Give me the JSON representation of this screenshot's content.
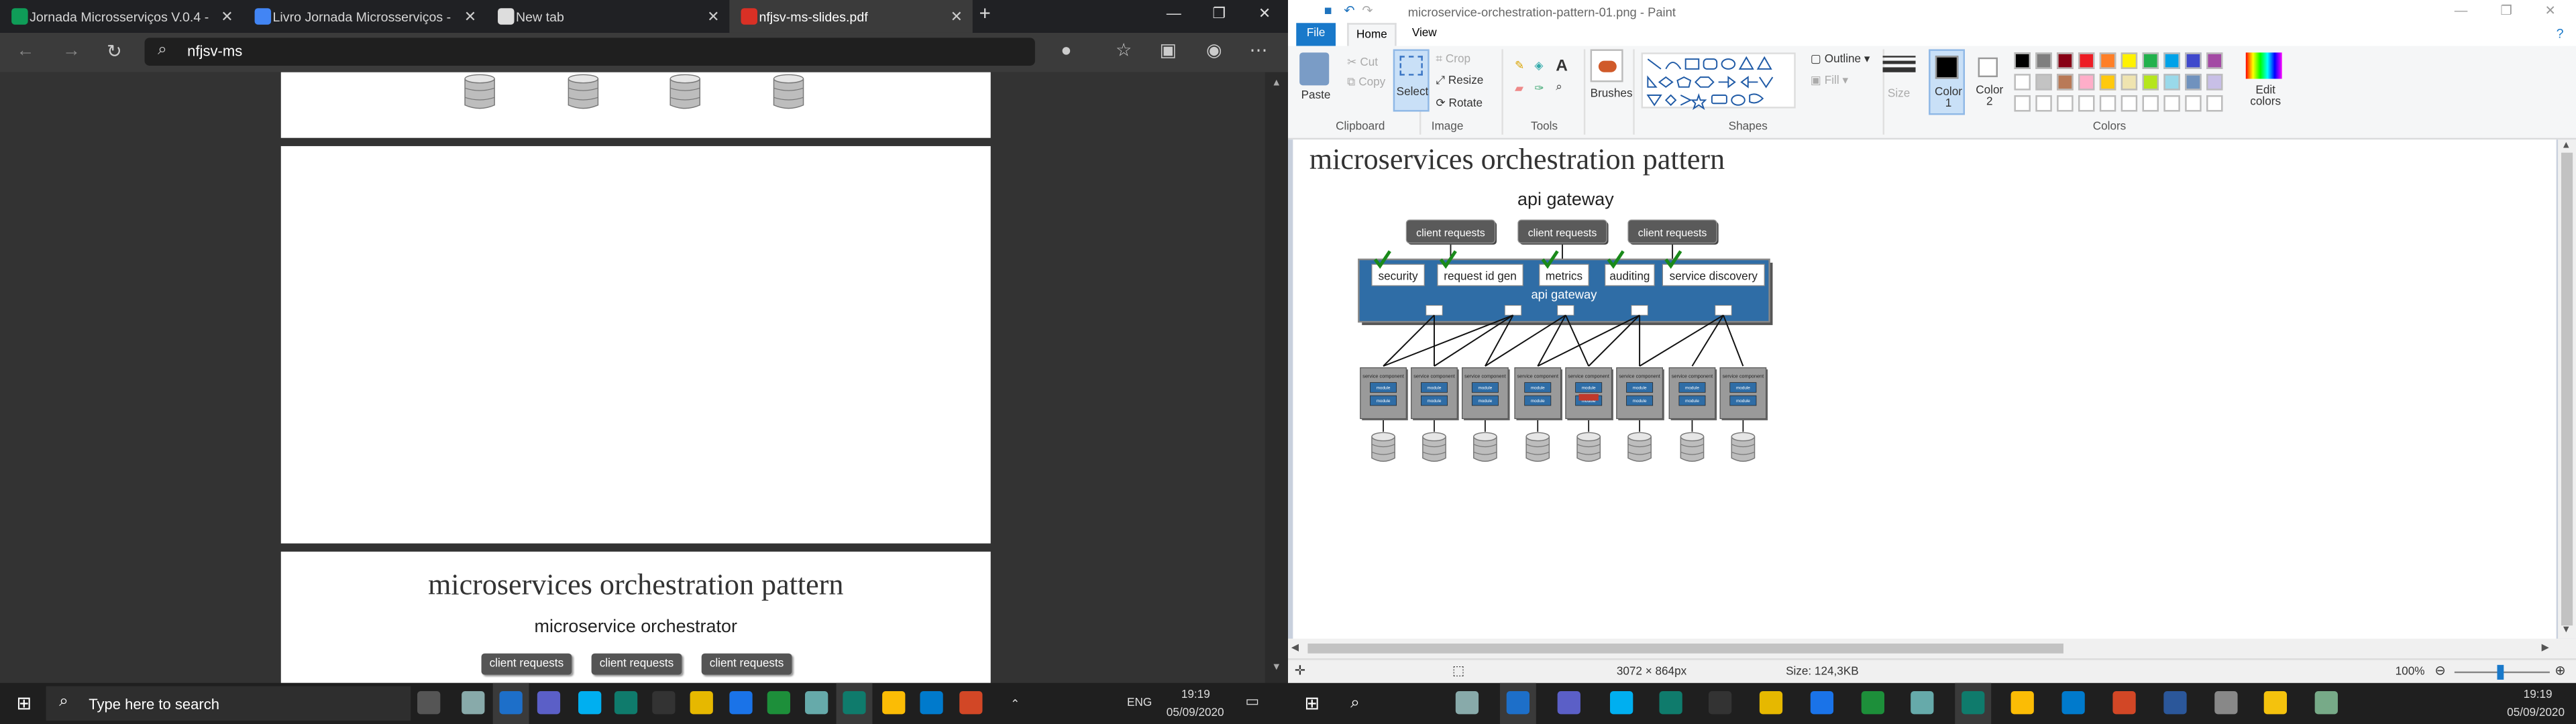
{
  "browser": {
    "tabs": [
      {
        "label": "Jornada Microsserviços V.0.4 - P"
      },
      {
        "label": "Livro Jornada Microsserviços - D"
      },
      {
        "label": "New tab"
      },
      {
        "label": "nfjsv-ms-slides.pdf"
      }
    ],
    "address": "nfjsv-ms",
    "slide_title": "microservices orchestration pattern",
    "slide_subtitle": "microservice orchestrator",
    "client_requests": "client requests"
  },
  "paint": {
    "title": "microservice-orchestration-pattern-01.png - Paint",
    "tabs": {
      "file": "File",
      "home": "Home",
      "view": "View"
    },
    "clipboard": {
      "paste": "Paste",
      "cut": "Cut",
      "copy": "Copy",
      "group": "Clipboard"
    },
    "image": {
      "select": "Select",
      "crop": "Crop",
      "resize": "Resize",
      "rotate": "Rotate",
      "group": "Image"
    },
    "tools": {
      "group": "Tools"
    },
    "brushes": {
      "label": "Brushes"
    },
    "shapes": {
      "outline": "Outline",
      "fill": "Fill",
      "group": "Shapes"
    },
    "size": {
      "label": "Size"
    },
    "colors": {
      "color1": "Color 1",
      "color2": "Color 2",
      "edit": "Edit colors",
      "group": "Colors"
    },
    "palette": [
      "#000000",
      "#7f7f7f",
      "#880015",
      "#ed1c24",
      "#ff7f27",
      "#fff200",
      "#22b14c",
      "#00a2e8",
      "#3f48cc",
      "#a349a4",
      "#ffffff",
      "#c3c3c3",
      "#b97a57",
      "#ffaec9",
      "#ffc90e",
      "#efe4b0",
      "#b5e61d",
      "#99d9ea",
      "#7092be",
      "#c8bfe7"
    ],
    "status": {
      "dimensions": "3072 × 864px",
      "size": "Size: 124,3KB",
      "zoom": "100%"
    }
  },
  "diagram": {
    "title": "microservices orchestration pattern",
    "subtitle": "api gateway",
    "client_requests": [
      "client requests",
      "client requests",
      "client requests"
    ],
    "gateway_label": "api gateway",
    "modules": [
      "security",
      "request id gen",
      "metrics",
      "auditing",
      "service discovery"
    ],
    "service_component": "service component",
    "module": "module"
  },
  "taskbar": {
    "search": "Type here to search",
    "lang": "ENG",
    "time_left": "19:19",
    "date_left": "05/09/2020",
    "time_right": "19:19",
    "date_right": "05/09/2020"
  }
}
